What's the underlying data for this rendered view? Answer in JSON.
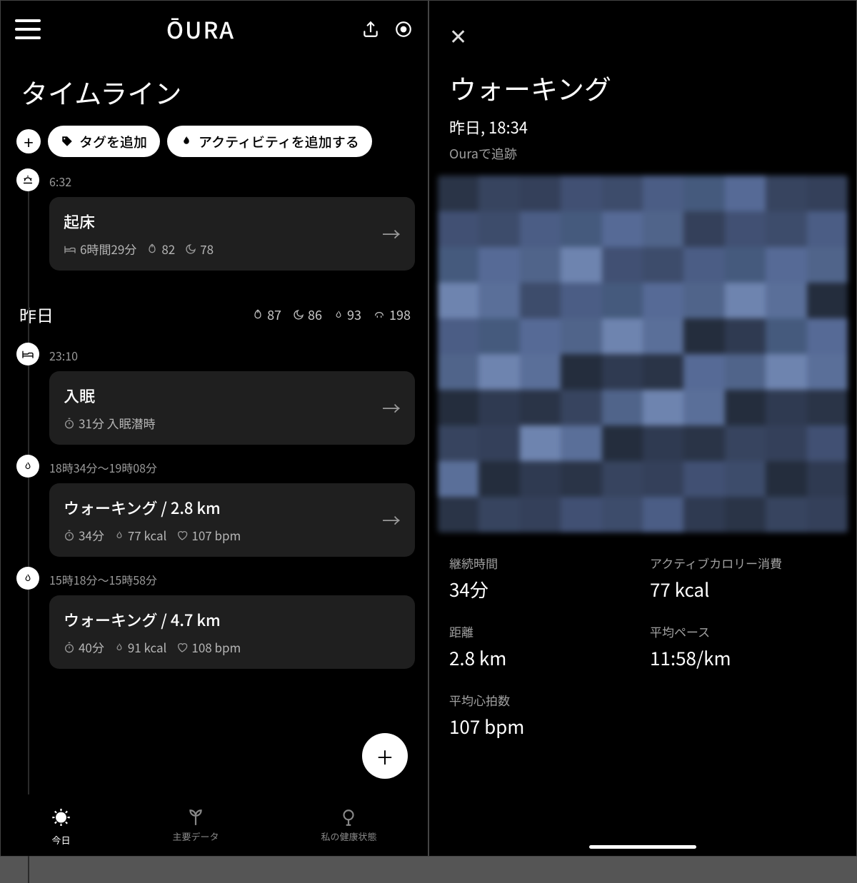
{
  "left": {
    "brand": "ŌURA",
    "page_title": "タイムライン",
    "add_tag_label": "タグを追加",
    "add_activity_label": "アクティビティを追加する",
    "today": {
      "wake_time": "6:32",
      "wake_card_title": "起床",
      "wake_card_sleep_dur": "6時間29分",
      "wake_card_readiness": "82",
      "wake_card_sleep_score": "78"
    },
    "yesterday": {
      "label": "昨日",
      "readiness": "87",
      "sleep": "86",
      "activity": "93",
      "resilience": "198",
      "events": [
        {
          "time": "23:10",
          "title": "入眠",
          "latency": "31分 入眠潜時"
        },
        {
          "time": "18時34分〜19時08分",
          "title": "ウォーキング / 2.8 km",
          "duration": "34分",
          "kcal": "77 kcal",
          "hr": "107 bpm"
        },
        {
          "time": "15時18分〜15時58分",
          "title": "ウォーキング / 4.7 km",
          "duration": "40分",
          "kcal": "91 kcal",
          "hr": "108 bpm"
        }
      ]
    },
    "nav": {
      "today": "今日",
      "vitals": "主要データ",
      "health": "私の健康状態"
    }
  },
  "right": {
    "title": "ウォーキング",
    "subtitle": "昨日, 18:34",
    "tracked_by": "Ouraで追跡",
    "stats": {
      "duration_label": "継続時間",
      "duration_value": "34分",
      "calories_label": "アクティブカロリー消費",
      "calories_value": "77 kcal",
      "distance_label": "距離",
      "distance_value": "2.8 km",
      "pace_label": "平均ペース",
      "pace_value": "11:58/km",
      "avg_hr_label": "平均心拍数",
      "avg_hr_value": "107 bpm"
    }
  }
}
